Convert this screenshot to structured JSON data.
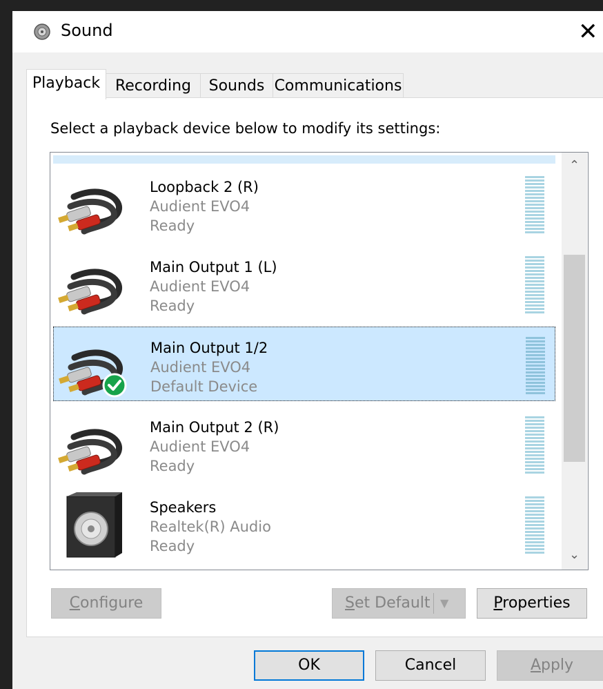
{
  "window": {
    "title": "Sound",
    "icon": "speaker-icon",
    "close_glyph": "✕"
  },
  "tabs": [
    {
      "label": "Playback",
      "active": true
    },
    {
      "label": "Recording",
      "active": false
    },
    {
      "label": "Sounds",
      "active": false
    },
    {
      "label": "Communications",
      "active": false
    }
  ],
  "instruction": "Select a playback device below to modify its settings:",
  "devices": [
    {
      "name": "Loopback 2 (R)",
      "device": "Audient EVO4",
      "status": "Ready",
      "icon": "rca-cable-icon",
      "selected": false,
      "default": false
    },
    {
      "name": "Main Output 1 (L)",
      "device": "Audient EVO4",
      "status": "Ready",
      "icon": "rca-cable-icon",
      "selected": false,
      "default": false
    },
    {
      "name": "Main Output 1/2",
      "device": "Audient EVO4",
      "status": "Default Device",
      "icon": "rca-cable-icon",
      "selected": true,
      "default": true
    },
    {
      "name": "Main Output 2 (R)",
      "device": "Audient EVO4",
      "status": "Ready",
      "icon": "rca-cable-icon",
      "selected": false,
      "default": false
    },
    {
      "name": "Speakers",
      "device": "Realtek(R) Audio",
      "status": "Ready",
      "icon": "speaker-box-icon",
      "selected": false,
      "default": false
    }
  ],
  "buttons": {
    "configure": {
      "label": "Configure",
      "accel": "C",
      "rest": "onfigure"
    },
    "set_default": {
      "label": "Set Default",
      "accel": "S",
      "rest": "et Default"
    },
    "properties": {
      "label": "Properties",
      "accel": "P",
      "rest": "roperties"
    },
    "ok": "OK",
    "cancel": "Cancel",
    "apply": {
      "label": "Apply",
      "accel": "A",
      "rest": "pply"
    }
  },
  "colors": {
    "selection": "#cce8ff",
    "focus_border": "#0078d7",
    "default_check": "#16a34a"
  }
}
